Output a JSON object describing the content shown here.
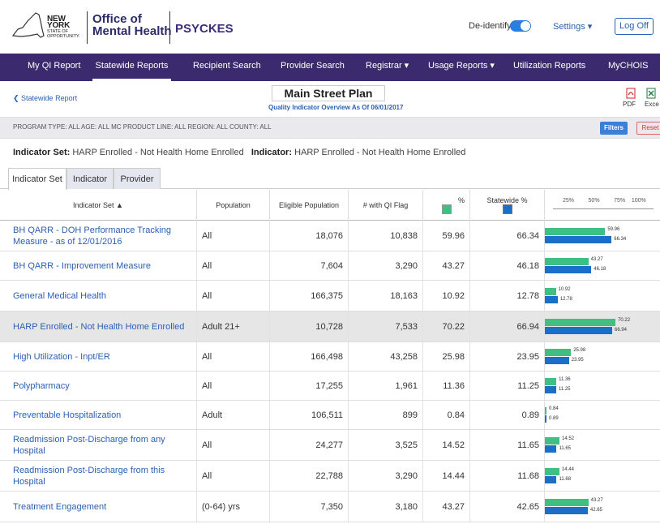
{
  "header": {
    "ny_logo_top": "NEW YORK",
    "ny_logo_mid": "STATE OF",
    "ny_logo_bot": "OPPORTUNITY.",
    "office_line1": "Office of",
    "office_line2": "Mental Health",
    "app_name": "PSYCKES",
    "deidentify_label": "De-identify",
    "settings_label": "Settings ▾",
    "logoff_label": "Log Off"
  },
  "nav": {
    "items": [
      "My QI Report",
      "Statewide Reports",
      "Recipient Search",
      "Provider Search",
      "Registrar ▾",
      "Usage Reports ▾",
      "Utilization Reports",
      "MyCHOIS"
    ],
    "active": "Statewide Reports"
  },
  "report": {
    "back_label": "❮ Statewide Report",
    "title": "Main Street Plan",
    "subtitle": "Quality Indicator Overview As Of 06/01/2017",
    "pdf_label": "PDF",
    "excel_label": "Exce"
  },
  "filters": {
    "text": "PROGRAM TYPE: ALL   AGE: ALL   MC PRODUCT LINE: ALL   REGION: ALL   COUNTY: ALL",
    "filters_btn": "Filters",
    "reset_btn": "Reset"
  },
  "indicator": {
    "set_label": "Indicator Set:",
    "set_value": "HARP Enrolled - Not Health Home Enrolled",
    "ind_label": "Indicator:",
    "ind_value": "HARP Enrolled - Not Health Home Enrolled"
  },
  "tabs": [
    "Indicator Set",
    "Indicator",
    "Provider"
  ],
  "columns": {
    "indicator_set": "Indicator Set ▲",
    "population": "Population",
    "eligible": "Eligible Population",
    "qi_flag": "# with QI Flag",
    "pct": "%",
    "statewide": "Statewide %",
    "axis": [
      "25%",
      "50%",
      "75%",
      "100%"
    ]
  },
  "colors": {
    "green": "#3fbf82",
    "blue": "#1a6fc9",
    "nav": "#3b2b6e",
    "link": "#2b5fb3"
  },
  "rows": [
    {
      "name": "BH QARR - DOH Performance Tracking Measure - as of 12/01/2016",
      "population": "All",
      "eligible": "18,076",
      "flag": "10,838",
      "pct": "59.96",
      "statewide": "66.34"
    },
    {
      "name": "BH QARR - Improvement Measure",
      "population": "All",
      "eligible": "7,604",
      "flag": "3,290",
      "pct": "43.27",
      "statewide": "46.18"
    },
    {
      "name": "General Medical Health",
      "population": "All",
      "eligible": "166,375",
      "flag": "18,163",
      "pct": "10.92",
      "statewide": "12.78"
    },
    {
      "name": "HARP Enrolled - Not Health Home Enrolled",
      "population": "Adult 21+",
      "eligible": "10,728",
      "flag": "7,533",
      "pct": "70.22",
      "statewide": "66.94"
    },
    {
      "name": "High Utilization - Inpt/ER",
      "population": "All",
      "eligible": "166,498",
      "flag": "43,258",
      "pct": "25.98",
      "statewide": "23.95"
    },
    {
      "name": "Polypharmacy",
      "population": "All",
      "eligible": "17,255",
      "flag": "1,961",
      "pct": "11.36",
      "statewide": "11.25"
    },
    {
      "name": "Preventable Hospitalization",
      "population": "Adult",
      "eligible": "106,511",
      "flag": "899",
      "pct": "0.84",
      "statewide": "0.89"
    },
    {
      "name": "Readmission Post-Discharge from any Hospital",
      "population": "All",
      "eligible": "24,277",
      "flag": "3,525",
      "pct": "14.52",
      "statewide": "11.65"
    },
    {
      "name": "Readmission Post-Discharge from this Hospital",
      "population": "All",
      "eligible": "22,788",
      "flag": "3,290",
      "pct": "14.44",
      "statewide": "11.68"
    },
    {
      "name": "Treatment Engagement",
      "population": "(0-64) yrs",
      "eligible": "7,350",
      "flag": "3,180",
      "pct": "43.27",
      "statewide": "42.65"
    }
  ]
}
